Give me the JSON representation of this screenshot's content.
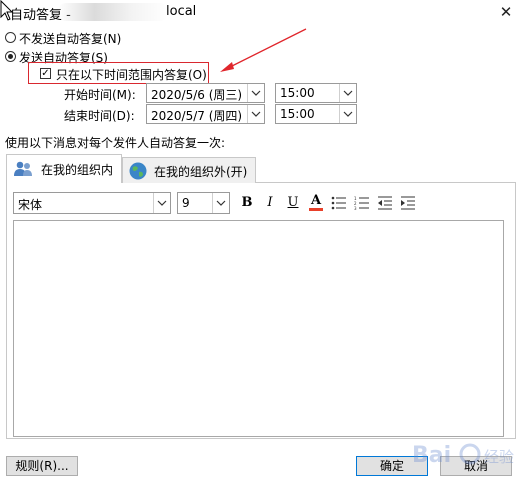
{
  "window": {
    "title_prefix": "自动答复 -",
    "title_suffix": "local",
    "close_glyph": "✕"
  },
  "options": {
    "no_reply_label": "不发送自动答复(N)",
    "send_reply_label": "发送自动答复(S)",
    "time_range_label": "只在以下时间范围内答复(O)",
    "start_label": "开始时间(M):",
    "end_label": "结束时间(D):",
    "start_date": "2020/5/6 (周三)",
    "start_time": "15:00",
    "end_date": "2020/5/7 (周四)",
    "end_time": "15:00",
    "selected": "send_reply",
    "time_range_checked": true
  },
  "instruction": "使用以下消息对每个发件人自动答复一次:",
  "tabs": [
    {
      "label": "在我的组织内",
      "icon": "people-icon",
      "active": true
    },
    {
      "label": "在我的组织外(开)",
      "icon": "globe-icon",
      "active": false
    }
  ],
  "toolbar": {
    "font_name": "宋体",
    "font_size": "9",
    "bold": "B",
    "italic": "I",
    "underline": "U",
    "font_color_glyph": "A",
    "font_color": "#e8402a"
  },
  "message_body": "",
  "buttons": {
    "rules": "规则(R)...",
    "ok": "确定",
    "cancel": "取消"
  },
  "watermark": {
    "text": "Bai 经验"
  }
}
